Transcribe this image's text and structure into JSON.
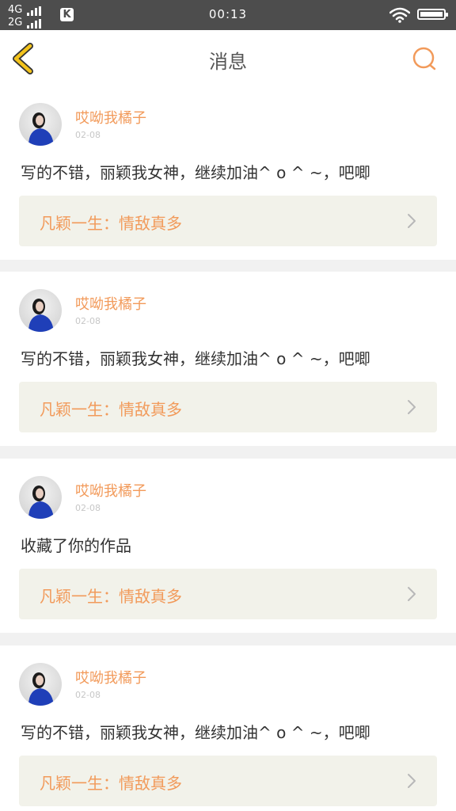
{
  "status_bar": {
    "network_1": "4G",
    "network_2": "2G",
    "app_badge": "K",
    "time": "00:13"
  },
  "nav": {
    "title": "消息"
  },
  "colors": {
    "accent": "#f29a5a",
    "back_chevron": "#f3c31c",
    "work_bg": "#f2f2ea"
  },
  "messages": [
    {
      "username": "哎呦我橘子",
      "date": "02-08",
      "comment": "写的不错，丽颖我女神，继续加油^ o ^ ~，吧唧",
      "work_title": "凡颖一生：情敌真多"
    },
    {
      "username": "哎呦我橘子",
      "date": "02-08",
      "comment": "写的不错，丽颖我女神，继续加油^ o ^ ~，吧唧",
      "work_title": "凡颖一生：情敌真多"
    },
    {
      "username": "哎呦我橘子",
      "date": "02-08",
      "comment": "收藏了你的作品",
      "work_title": "凡颖一生：情敌真多"
    },
    {
      "username": "哎呦我橘子",
      "date": "02-08",
      "comment": "写的不错，丽颖我女神，继续加油^ o ^ ~，吧唧",
      "work_title": "凡颖一生：情敌真多"
    }
  ]
}
